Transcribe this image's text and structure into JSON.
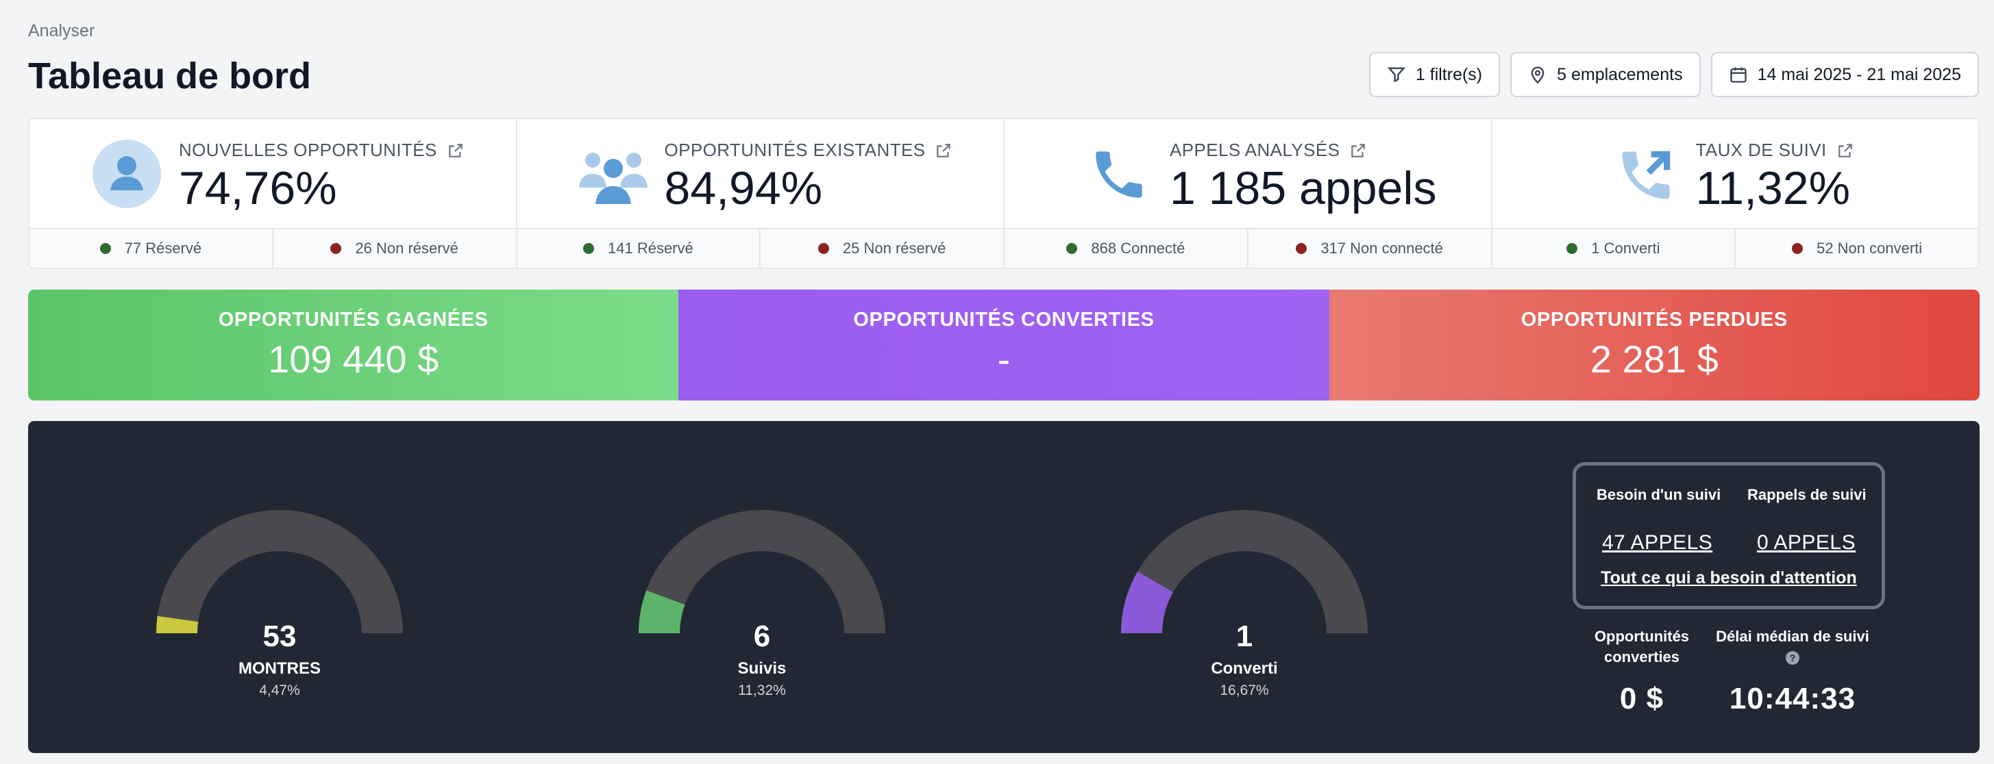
{
  "header": {
    "breadcrumb": "Analyser",
    "title": "Tableau de bord",
    "filters": {
      "filter_label": "1 filtre(s)",
      "locations_label": "5 emplacements",
      "date_range": "14 mai 2025 - 21 mai 2025"
    }
  },
  "stats": [
    {
      "label": "NOUVELLES OPPORTUNITÉS",
      "value": "74,76%",
      "icon": "user-circle-icon",
      "left": {
        "text": "77 Réservé",
        "color": "#2f6b2f"
      },
      "right": {
        "text": "26 Non réservé",
        "color": "#8b2420"
      }
    },
    {
      "label": "OPPORTUNITÉS EXISTANTES",
      "value": "84,94%",
      "icon": "users-group-icon",
      "left": {
        "text": "141 Réservé",
        "color": "#2f6b2f"
      },
      "right": {
        "text": "25 Non réservé",
        "color": "#8b2420"
      }
    },
    {
      "label": "APPELS ANALYSÉS",
      "value": "1 185 appels",
      "icon": "phone-icon",
      "left": {
        "text": "868 Connecté",
        "color": "#2f6b2f"
      },
      "right": {
        "text": "317 Non connecté",
        "color": "#8b2420"
      }
    },
    {
      "label": "TAUX DE SUIVI",
      "value": "11,32%",
      "icon": "phone-outgoing-icon",
      "left": {
        "text": "1 Converti",
        "color": "#2f6b2f"
      },
      "right": {
        "text": "52 Non converti",
        "color": "#8b2420"
      }
    }
  ],
  "bands": [
    {
      "label": "OPPORTUNITÉS GAGNÉES",
      "value": "109 440 $",
      "color_from": "#5cc468",
      "color_to": "#7bdc8a"
    },
    {
      "label": "OPPORTUNITÉS CONVERTIES",
      "value": "-",
      "color_from": "#9b5cf0",
      "color_to": "#a063f2"
    },
    {
      "label": "OPPORTUNITÉS PERDUES",
      "value": "2 281 $",
      "color_from": "#e87a72",
      "color_to": "#e0473f"
    }
  ],
  "gauges": [
    {
      "number": "53",
      "label": "MONTRES",
      "percent": "4,47%",
      "fraction": 0.0447,
      "color": "#c9c83e"
    },
    {
      "number": "6",
      "label": "Suivis",
      "percent": "11,32%",
      "fraction": 0.1132,
      "color": "#5cb46a"
    },
    {
      "number": "1",
      "label": "Converti",
      "percent": "16,67%",
      "fraction": 0.1667,
      "color": "#8b5ad8"
    }
  ],
  "follow": {
    "need_label": "Besoin d'un suivi",
    "need_value": "47 APPELS",
    "reminders_label": "Rappels de suivi",
    "reminders_value": "0 APPELS",
    "all_link": "Tout ce qui a besoin d'attention"
  },
  "kpis": {
    "converted_label": "Opportunités converties",
    "converted_value": "0 $",
    "median_label": "Délai médian de suivi",
    "median_value": "10:44:33"
  },
  "colors": {
    "accent_blue": "#5b9bd5",
    "track_gray": "#4a4a4e",
    "dark_panel": "#222833"
  }
}
